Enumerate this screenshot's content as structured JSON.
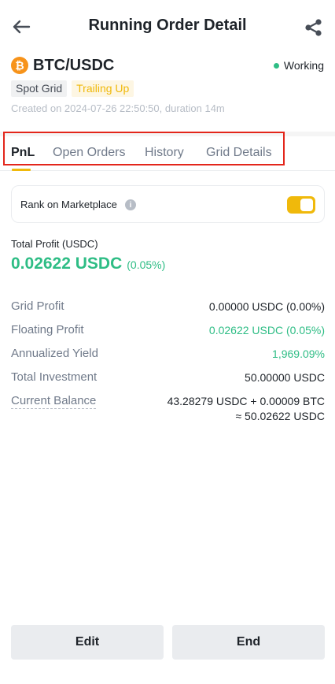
{
  "header": {
    "title": "Running Order Detail",
    "back_icon": "arrow-left-icon",
    "share_icon": "share-icon"
  },
  "order": {
    "coin_icon": "bitcoin-icon",
    "pair": "BTC/USDC",
    "status": "Working",
    "status_color": "#2ebd85",
    "tags": [
      "Spot Grid",
      "Trailing Up"
    ],
    "created": "Created on 2024-07-26 22:50:50, duration 14m"
  },
  "tabs": [
    {
      "label": "PnL",
      "active": true
    },
    {
      "label": "Open Orders",
      "active": false
    },
    {
      "label": "History",
      "active": false
    },
    {
      "label": "Grid Details",
      "active": false
    }
  ],
  "rank": {
    "label": "Rank on Marketplace",
    "info_icon": "info-icon",
    "toggle_on": true
  },
  "total_profit": {
    "label": "Total Profit (USDC)",
    "value": "0.02622 USDC",
    "pct": "(0.05%)"
  },
  "stats": [
    {
      "label": "Grid Profit",
      "value": "0.00000 USDC (0.00%)"
    },
    {
      "label": "Floating Profit",
      "value": "0.02622 USDC (0.05%)"
    },
    {
      "label": "Annualized Yield",
      "value": "1,969.09%"
    },
    {
      "label": "Total Investment",
      "value": "50.00000 USDC"
    },
    {
      "label": "Current Balance",
      "value_line1": "43.28279 USDC + 0.00009 BTC",
      "value_line2": "≈ 50.02622 USDC"
    }
  ],
  "buttons": {
    "edit": "Edit",
    "end": "End"
  },
  "colors": {
    "accent": "#f0b90b",
    "profit_green": "#2ebd85",
    "highlight_red": "#e3261b"
  }
}
